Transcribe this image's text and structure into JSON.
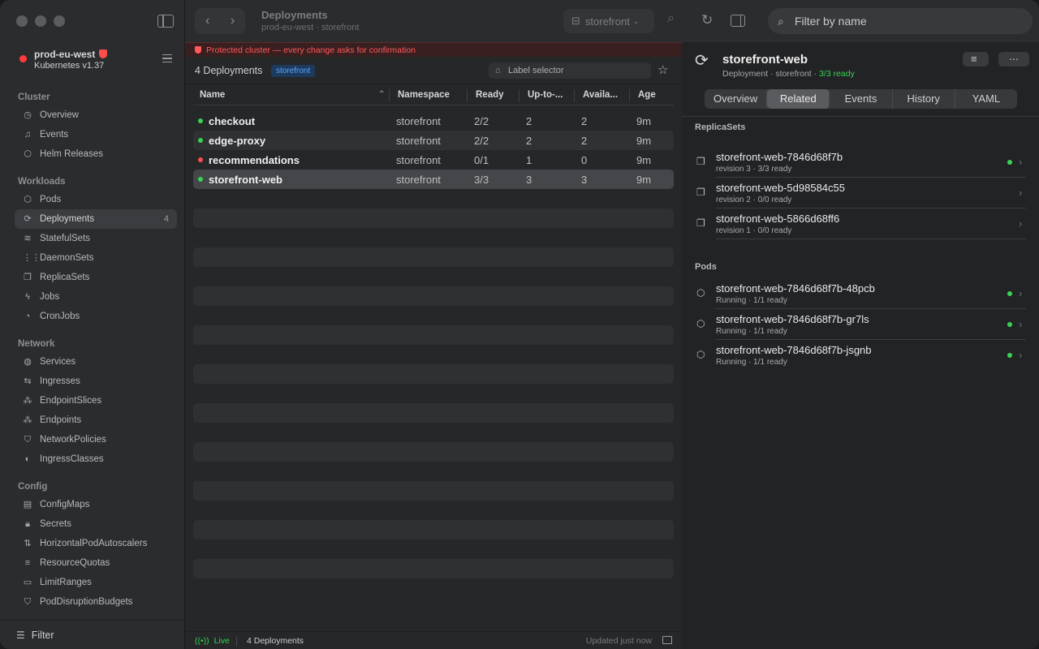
{
  "sidebar": {
    "cluster_name": "prod-eu-west",
    "cluster_version": "Kubernetes v1.37",
    "sections": [
      {
        "title": "Cluster",
        "items": [
          {
            "label": "Overview",
            "icon": "clock-icon"
          },
          {
            "label": "Events",
            "icon": "bell-icon"
          },
          {
            "label": "Helm Releases",
            "icon": "cube-icon"
          }
        ]
      },
      {
        "title": "Workloads",
        "items": [
          {
            "label": "Pods",
            "icon": "cube-icon"
          },
          {
            "label": "Deployments",
            "icon": "sync-icon",
            "count": "4",
            "active": true
          },
          {
            "label": "StatefulSets",
            "icon": "stack-icon"
          },
          {
            "label": "DaemonSets",
            "icon": "grid-icon"
          },
          {
            "label": "ReplicaSets",
            "icon": "copy-icon"
          },
          {
            "label": "Jobs",
            "icon": "bolt-icon"
          },
          {
            "label": "CronJobs",
            "icon": "timer-icon"
          }
        ]
      },
      {
        "title": "Network",
        "items": [
          {
            "label": "Services",
            "icon": "globe-icon"
          },
          {
            "label": "Ingresses",
            "icon": "arrows-icon"
          },
          {
            "label": "EndpointSlices",
            "icon": "nodes-icon"
          },
          {
            "label": "Endpoints",
            "icon": "nodes-icon"
          },
          {
            "label": "NetworkPolicies",
            "icon": "shield-icon"
          },
          {
            "label": "IngressClasses",
            "icon": "half-circle-icon"
          }
        ]
      },
      {
        "title": "Config",
        "items": [
          {
            "label": "ConfigMaps",
            "icon": "doc-icon"
          },
          {
            "label": "Secrets",
            "icon": "lock-icon"
          },
          {
            "label": "HorizontalPodAutoscalers",
            "icon": "updown-icon"
          },
          {
            "label": "ResourceQuotas",
            "icon": "sliders-icon"
          },
          {
            "label": "LimitRanges",
            "icon": "ruler-icon"
          },
          {
            "label": "PodDisruptionBudgets",
            "icon": "shield-icon"
          }
        ]
      }
    ],
    "filter_label": "Filter"
  },
  "toolbar": {
    "title": "Deployments",
    "subtitle": "prod-eu-west · storefront",
    "namespace": "storefront"
  },
  "banner": "Protected cluster — every change asks for confirmation",
  "list": {
    "count_label": "4 Deployments",
    "namespace_tag": "storefront",
    "label_selector_placeholder": "Label selector",
    "columns": [
      "Name",
      "Namespace",
      "Ready",
      "Up-to-...",
      "Availa...",
      "Age"
    ],
    "rows": [
      {
        "name": "checkout",
        "namespace": "storefront",
        "ready": "2/2",
        "uptodate": "2",
        "available": "2",
        "age": "9m",
        "status_color": "#39d353"
      },
      {
        "name": "edge-proxy",
        "namespace": "storefront",
        "ready": "2/2",
        "uptodate": "2",
        "available": "2",
        "age": "9m",
        "status_color": "#39d353"
      },
      {
        "name": "recommendations",
        "namespace": "storefront",
        "ready": "0/1",
        "uptodate": "1",
        "available": "0",
        "age": "9m",
        "status_color": "#ff4d4d"
      },
      {
        "name": "storefront-web",
        "namespace": "storefront",
        "ready": "3/3",
        "uptodate": "3",
        "available": "3",
        "age": "9m",
        "status_color": "#39d353",
        "selected": true
      }
    ]
  },
  "statusbar": {
    "live": "Live",
    "count": "4 Deployments",
    "updated": "Updated just now"
  },
  "detail": {
    "filter_placeholder": "Filter by name",
    "title": "storefront-web",
    "kind": "Deployment",
    "namespace": "storefront",
    "ready": "3/3 ready",
    "tabs": [
      "Overview",
      "Related",
      "Events",
      "History",
      "YAML"
    ],
    "active_tab": 1,
    "replicasets_title": "ReplicaSets",
    "replicasets": [
      {
        "name": "storefront-web-7846d68f7b",
        "sub": "revision 3 · 3/3 ready",
        "healthy": true
      },
      {
        "name": "storefront-web-5d98584c55",
        "sub": "revision 2 · 0/0 ready",
        "healthy": false
      },
      {
        "name": "storefront-web-5866d68ff6",
        "sub": "revision 1 · 0/0 ready",
        "healthy": false
      }
    ],
    "pods_title": "Pods",
    "pods": [
      {
        "name": "storefront-web-7846d68f7b-48pcb",
        "sub": "Running · 1/1 ready",
        "healthy": true
      },
      {
        "name": "storefront-web-7846d68f7b-gr7ls",
        "sub": "Running · 1/1 ready",
        "healthy": true
      },
      {
        "name": "storefront-web-7846d68f7b-jsgnb",
        "sub": "Running · 1/1 ready",
        "healthy": true
      }
    ]
  }
}
